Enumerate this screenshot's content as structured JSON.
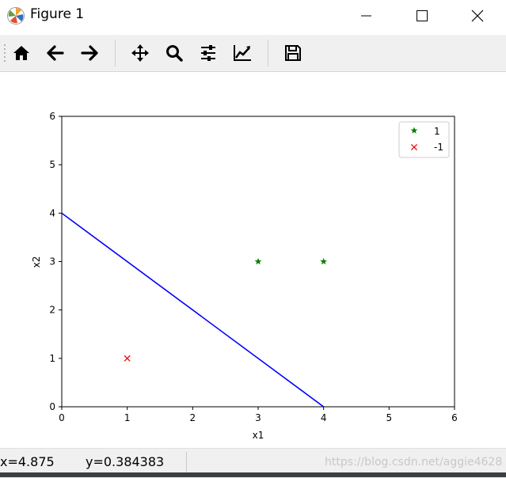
{
  "window": {
    "title": "Figure 1",
    "icons": [
      "matplotlib-logo-icon",
      "minimize-icon",
      "maximize-icon",
      "close-icon"
    ]
  },
  "toolbar": {
    "buttons": [
      {
        "name": "home-icon"
      },
      {
        "name": "back-arrow-icon"
      },
      {
        "name": "forward-arrow-icon"
      },
      {
        "name": "pan-move-icon"
      },
      {
        "name": "zoom-magnifier-icon"
      },
      {
        "name": "configure-subplots-icon"
      },
      {
        "name": "edit-axis-icon"
      },
      {
        "name": "save-floppy-icon"
      }
    ]
  },
  "status": {
    "x": "x=4.875",
    "y": "y=0.384383",
    "watermark": "https://blog.csdn.net/aggie4628"
  },
  "chart_data": {
    "type": "scatter",
    "xlabel": "x1",
    "ylabel": "x2",
    "xlim": [
      0,
      6
    ],
    "ylim": [
      0,
      6
    ],
    "xticks": [
      "0",
      "1",
      "2",
      "3",
      "4",
      "5",
      "6"
    ],
    "yticks": [
      "0",
      "1",
      "2",
      "3",
      "4",
      "5",
      "6"
    ],
    "grid": false,
    "legend_position": "top-right",
    "series": [
      {
        "name": "1",
        "marker": "star",
        "color": "#008000",
        "points": [
          [
            3,
            3
          ],
          [
            4,
            3
          ]
        ]
      },
      {
        "name": "-1",
        "marker": "x",
        "color": "#ff0000",
        "points": [
          [
            1,
            1
          ]
        ]
      }
    ],
    "line": {
      "color": "#0000ff",
      "points": [
        [
          0,
          4
        ],
        [
          4,
          0
        ]
      ]
    }
  }
}
